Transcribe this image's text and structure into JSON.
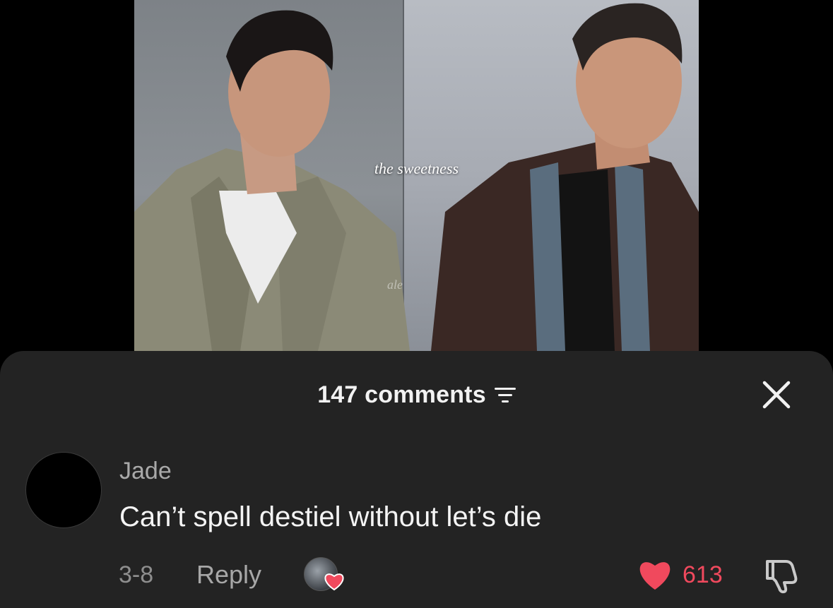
{
  "video": {
    "caption": "the sweetness",
    "watermark": "ale"
  },
  "comments_sheet": {
    "count_label": "147 comments",
    "sort_icon": "sort-filter-icon",
    "close_icon": "close-icon"
  },
  "comment": {
    "avatar_icon": "crescent-moon-avatar",
    "author": "Jade",
    "text": "Can’t spell destiel without let’s die",
    "date": "3-8",
    "reply_label": "Reply",
    "liked_by_creator_icon": "creator-liked-heart-icon",
    "like_icon": "heart-icon",
    "like_count": "613",
    "dislike_icon": "thumbs-down-icon"
  },
  "colors": {
    "sheet_background": "#232323",
    "like_red": "#f0495d",
    "text_primary": "#f4f4f4",
    "text_secondary": "#a9a9a9"
  }
}
